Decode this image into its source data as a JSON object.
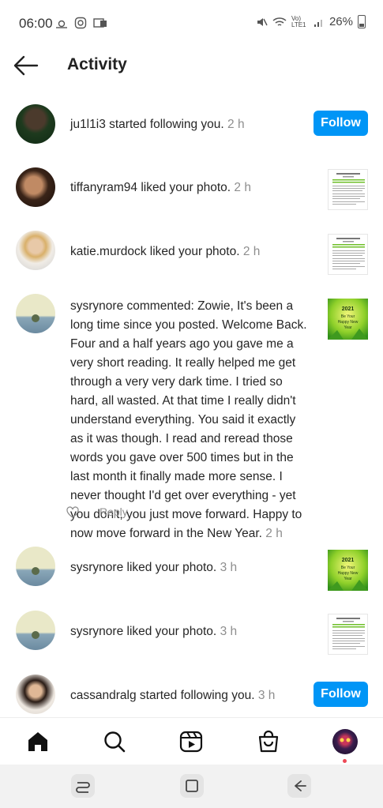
{
  "status_bar": {
    "time": "06:00",
    "network": "Vo) LTE1",
    "battery": "26%"
  },
  "header": {
    "title": "Activity"
  },
  "activity": [
    {
      "username": "ju1l1i3",
      "action": "started following you.",
      "time": "2 h",
      "button": "Follow"
    },
    {
      "username": "tiffanyram94",
      "action": "liked your photo.",
      "time": "2 h"
    },
    {
      "username": "katie.murdock",
      "action": "liked your photo.",
      "time": "2 h"
    },
    {
      "username": "sysrynore",
      "action": "commented: Zowie, It's been a long time since you posted. Welcome Back.  Four and a half years ago you gave me a very short reading. It really helped me get through a very very dark time. I tried so hard, all wasted. At that time I really didn't understand everything. You said it exactly as it was though. I read and reread those words you gave over 500 times but in the last month it finally made more sense. I never thought I'd get over everything - yet you don't, you just move forward. Happy to now move forward in the New Year.",
      "time": "2 h",
      "reply_label": "Reply"
    },
    {
      "username": "sysrynore",
      "action": "liked your photo.",
      "time": "3 h"
    },
    {
      "username": "sysrynore",
      "action": "liked your photo.",
      "time": "3 h"
    },
    {
      "username": "cassandralg",
      "action": "started following you.",
      "time": "3 h",
      "button": "Follow"
    }
  ],
  "thumbnails": {
    "new_year_text": "2021\nBe Your\nHappy New\nYear",
    "doc_title": "Tuesday 1st January 2019"
  },
  "colors": {
    "follow_button": "#0095f6",
    "time_text": "#8e8e8e",
    "notification_dot": "#ed4956"
  },
  "icons": {
    "nav": [
      "home-icon",
      "search-icon",
      "reels-icon",
      "shop-icon",
      "profile-avatar"
    ],
    "system": [
      "recents-icon",
      "home-square-icon",
      "back-icon"
    ]
  }
}
